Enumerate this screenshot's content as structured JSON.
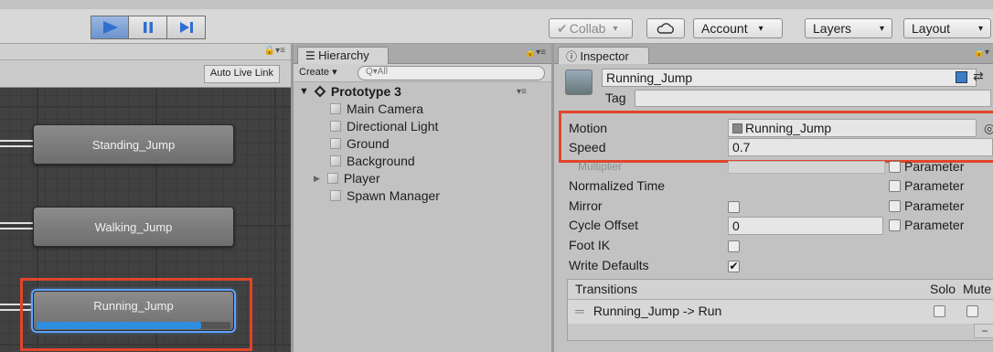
{
  "toolbar": {
    "play_icon": "play-icon",
    "pause_icon": "pause-icon",
    "step_icon": "step-icon",
    "collab_label": "Collab",
    "cloud_icon": "cloud-icon",
    "account_label": "Account",
    "layers_label": "Layers",
    "layout_label": "Layout",
    "accent_color": "#5b8fd6"
  },
  "animator": {
    "auto_live_link_label": "Auto Live Link",
    "states": [
      "Standing_Jump",
      "Walking_Jump",
      "Running_Jump"
    ],
    "active_state": "Running_Jump",
    "active_progress": 0.85
  },
  "hierarchy": {
    "tab_label": "Hierarchy",
    "create_label": "Create",
    "search_placeholder": "Q▾All",
    "scene_name": "Prototype 3",
    "items": [
      "Main Camera",
      "Directional Light",
      "Ground",
      "Background",
      "Player",
      "Spawn Manager"
    ]
  },
  "inspector": {
    "tab_label": "Inspector",
    "object_name": "Running_Jump",
    "tag_label": "Tag",
    "motion_label": "Motion",
    "motion_value": "Running_Jump",
    "speed_label": "Speed",
    "speed_value": "0.7",
    "multiplier_label": "Multiplier",
    "normalized_time_label": "Normalized Time",
    "mirror_label": "Mirror",
    "cycle_offset_label": "Cycle Offset",
    "cycle_offset_value": "0",
    "foot_ik_label": "Foot IK",
    "write_defaults_label": "Write Defaults",
    "write_defaults_checked": true,
    "parameter_label": "Parameter",
    "transitions_label": "Transitions",
    "solo_label": "Solo",
    "mute_label": "Mute",
    "transition_entry": "Running_Jump -> Run",
    "highlight_color": "#e0452a"
  }
}
